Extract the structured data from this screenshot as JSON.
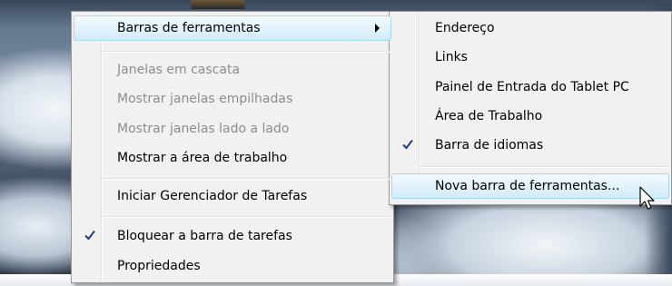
{
  "main_menu": {
    "toolbars": {
      "label": "Barras de ferramentas",
      "highlighted": true,
      "submenu_arrow": "chevron-right-icon"
    },
    "cascade": {
      "label": "Janelas em cascata",
      "disabled": true
    },
    "stacked": {
      "label": "Mostrar janelas empilhadas",
      "disabled": true
    },
    "side_by_side": {
      "label": "Mostrar janelas lado a lado",
      "disabled": true
    },
    "show_desktop": {
      "label": "Mostrar a área de trabalho",
      "disabled": false
    },
    "task_manager": {
      "label": "Iniciar Gerenciador de Tarefas"
    },
    "lock_taskbar": {
      "label": "Bloquear a barra de tarefas",
      "checked": true
    },
    "properties": {
      "label": "Propriedades"
    }
  },
  "toolbars_submenu": {
    "address": {
      "label": "Endereço",
      "checked": false
    },
    "links": {
      "label": "Links",
      "checked": false
    },
    "tablet_input": {
      "label": "Painel de Entrada do Tablet PC",
      "checked": false
    },
    "desktop": {
      "label": "Área de Trabalho",
      "checked": false
    },
    "language_bar": {
      "label": "Barra de idiomas",
      "checked": true
    },
    "new_toolbar": {
      "label": "Nova barra de ferramentas...",
      "highlighted": true
    }
  },
  "colors": {
    "highlight_border": "#a8d8eb",
    "highlight_fill": "#e1f2fb",
    "menu_background": "#f1f1f1",
    "disabled_text": "#8d8d8d",
    "check_mark": "#1c3d8c"
  },
  "icons": [
    "chevron-right-icon",
    "checkmark-icon",
    "mouse-pointer-icon"
  ]
}
